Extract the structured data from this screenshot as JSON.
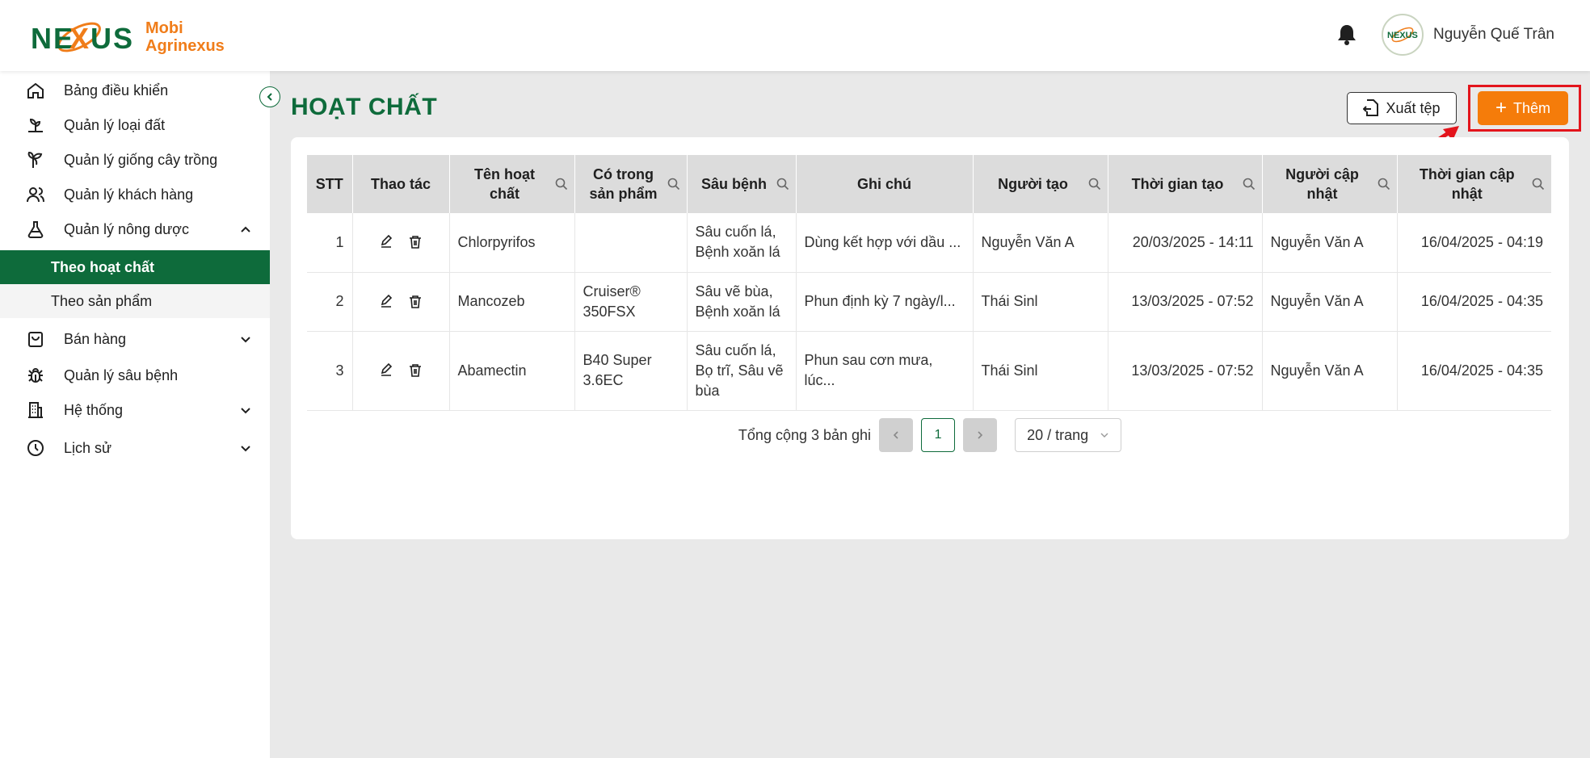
{
  "brand": {
    "name_line1": "Mobi",
    "name_line2": "Agrinexus",
    "logo_text": "NEXUS",
    "color_primary": "#0e6b3b",
    "color_accent": "#f57c0a"
  },
  "user": {
    "name": "Nguyễn Quế Trân",
    "avatar_text": "NEXUS"
  },
  "sidebar": {
    "items": [
      {
        "label": "Bảng điều khiển",
        "icon": "home-icon"
      },
      {
        "label": "Quản lý loại đất",
        "icon": "soil-icon"
      },
      {
        "label": "Quản lý giống cây trồng",
        "icon": "plant-icon"
      },
      {
        "label": "Quản lý khách hàng",
        "icon": "users-icon"
      },
      {
        "label": "Quản lý nông dược",
        "icon": "flask-icon",
        "expanded": true
      },
      {
        "label": "Bán hàng",
        "icon": "shopping-bag-icon"
      },
      {
        "label": "Quản lý sâu bệnh",
        "icon": "bug-icon"
      },
      {
        "label": "Hệ thống",
        "icon": "building-icon"
      },
      {
        "label": "Lịch sử",
        "icon": "clock-icon"
      }
    ],
    "sub_items": [
      {
        "label": "Theo hoạt chất",
        "active": true
      },
      {
        "label": "Theo sản phẩm",
        "active": false
      }
    ]
  },
  "page": {
    "title": "HOẠT CHẤT",
    "export_label": "Xuất tệp",
    "add_label": "Thêm"
  },
  "table": {
    "headers": {
      "stt": "STT",
      "actions": "Thao tác",
      "name_1": "Tên hoạt",
      "name_2": "chất",
      "product_1": "Có trong",
      "product_2": "sản phẩm",
      "pest": "Sâu bệnh",
      "note": "Ghi chú",
      "creator": "Người tạo",
      "created_at": "Thời gian tạo",
      "updater_1": "Người cập",
      "updater_2": "nhật",
      "updated_at_1": "Thời gian cập",
      "updated_at_2": "nhật"
    },
    "rows": [
      {
        "stt": "1",
        "name": "Chlorpyrifos",
        "product_1": "",
        "product_2": "",
        "pest_1": "Sâu cuốn lá,",
        "pest_2": "Bệnh xoăn lá",
        "pest_3": "",
        "note": "Dùng kết hợp với dầu ...",
        "creator": "Nguyễn Văn A",
        "created_at": "20/03/2025 - 14:11",
        "updater": "Nguyễn Văn A",
        "updated_at": "16/04/2025 - 04:19"
      },
      {
        "stt": "2",
        "name": "Mancozeb",
        "product_1": "Cruiser®",
        "product_2": "350FSX",
        "pest_1": "Sâu vẽ bùa,",
        "pest_2": "Bệnh xoăn lá",
        "pest_3": "",
        "note": "Phun định kỳ 7 ngày/l...",
        "creator": "Thái Sinl",
        "created_at": "13/03/2025 - 07:52",
        "updater": "Nguyễn Văn A",
        "updated_at": "16/04/2025 - 04:35"
      },
      {
        "stt": "3",
        "name": "Abamectin",
        "product_1": "B40 Super",
        "product_2": "3.6EC",
        "pest_1": "Sâu cuốn lá,",
        "pest_2": "Bọ trĩ, Sâu vẽ",
        "pest_3": "bùa",
        "note": "Phun sau cơn mưa, lúc...",
        "creator": "Thái Sinl",
        "created_at": "13/03/2025 - 07:52",
        "updater": "Nguyễn Văn A",
        "updated_at": "16/04/2025 - 04:35"
      }
    ]
  },
  "pagination": {
    "total_label": "Tổng cộng 3 bản ghi",
    "current_page": "1",
    "page_size": "20 / trang"
  }
}
